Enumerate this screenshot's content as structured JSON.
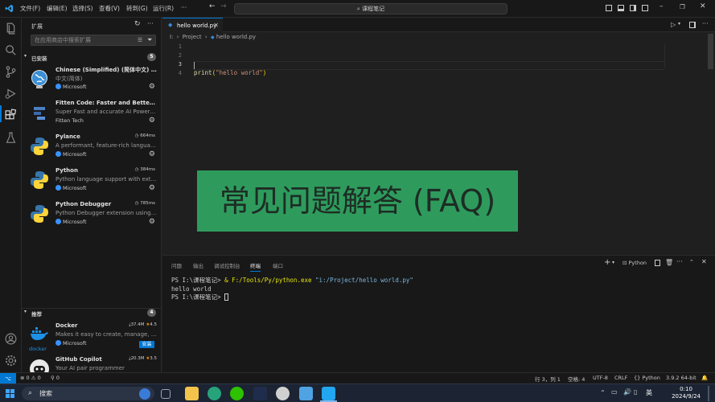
{
  "menu": [
    "文件(F)",
    "编辑(E)",
    "选择(S)",
    "查看(V)",
    "转到(G)",
    "运行(R)"
  ],
  "search": {
    "label": "课程笔记"
  },
  "sidebar": {
    "title": "扩展",
    "search_placeholder": "在应用商店中搜索扩展",
    "installed": {
      "label": "已安装",
      "count": "5"
    },
    "recommended": {
      "label": "推荐",
      "count": "4"
    },
    "extensions": [
      {
        "name": "Chinese (Simplified) (简体中文) L...",
        "desc": "中文(简体)",
        "publisher": "Microsoft",
        "time": ""
      },
      {
        "name": "Fitten Code: Faster and Better AI ...",
        "desc": "Super Fast and accurate AI Powered...",
        "publisher": "Fitten Tech",
        "time": ""
      },
      {
        "name": "Pylance",
        "desc": "A performant, feature-rich languag...",
        "publisher": "Microsoft",
        "time": "664ms"
      },
      {
        "name": "Python",
        "desc": "Python language support with exte...",
        "publisher": "Microsoft",
        "time": "384ms"
      },
      {
        "name": "Python Debugger",
        "desc": "Python Debugger extension using d...",
        "publisher": "Microsoft",
        "time": "785ms"
      }
    ],
    "recommended_items": [
      {
        "name": "Docker",
        "desc": "Makes it easy to create, manage, an...",
        "publisher": "Microsoft",
        "downloads": "37.4M",
        "rating": "4.5",
        "install": "安装",
        "logo_text": "docker"
      },
      {
        "name": "GitHub Copilot",
        "desc": "Your AI pair programmer",
        "publisher": "",
        "downloads": "20.3M",
        "rating": "3.5",
        "install": "",
        "logo_text": ""
      }
    ]
  },
  "editor": {
    "tab": "hello world.py",
    "breadcrumb": {
      "root": "I:",
      "folder": "Project",
      "file": "hello world.py"
    },
    "line_numbers": [
      "1",
      "2",
      "3",
      "4"
    ],
    "code": {
      "fn": "print",
      "open": "(",
      "str": "\"hello world\"",
      "close": ")"
    }
  },
  "banner": {
    "text": "常见问题解答 (FAQ)"
  },
  "panel": {
    "tabs": [
      "问题",
      "输出",
      "调试控制台",
      "终端",
      "端口"
    ],
    "shell": "Python",
    "terminal": {
      "line1_prompt": "PS I:\\课程笔记> ",
      "line1_amp": "& ",
      "line1_exe": "F:/Tools/Py/python.exe",
      "line1_arg": " \"i:/Project/hello world.py\"",
      "line2": "hello world",
      "line3": "PS I:\\课程笔记> "
    }
  },
  "status": {
    "errors": "0",
    "warnings": "0",
    "ports": "0",
    "position": "行 3，列 1",
    "spaces": "空格: 4",
    "encoding": "UTF-8",
    "eol": "CRLF",
    "language": "Python",
    "interpreter": "3.9.2 64-bit"
  },
  "taskbar": {
    "search": "搜索",
    "ime": "英",
    "time": "0:10",
    "date": "2024/9/24"
  },
  "colors": {
    "accent": "#0078d4",
    "banner": "#2e9b5d",
    "string": "#ce9178",
    "function": "#dcdcaa"
  }
}
